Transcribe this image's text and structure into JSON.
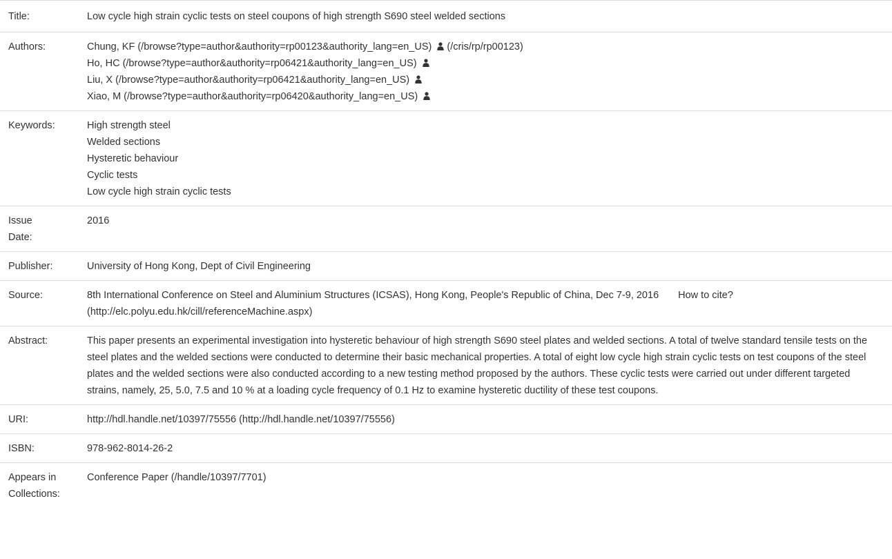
{
  "record": {
    "title": {
      "label": "Title:",
      "value": "Low cycle high strain cyclic tests on steel coupons of high strength S690 steel welded sections"
    },
    "authors": {
      "label": "Authors:",
      "items": [
        {
          "text": "Chung, KF (/browse?type=author&authority=rp00123&authority_lang=en_US)",
          "icon": "user-icon",
          "profile": "(/cris/rp/rp00123)"
        },
        {
          "text": "Ho, HC (/browse?type=author&authority=rp06421&authority_lang=en_US)",
          "icon": "user-icon"
        },
        {
          "text": "Liu, X (/browse?type=author&authority=rp06421&authority_lang=en_US)",
          "icon": "user-icon"
        },
        {
          "text": "Xiao, M (/browse?type=author&authority=rp06420&authority_lang=en_US)",
          "icon": "user-icon"
        }
      ]
    },
    "keywords": {
      "label": "Keywords:",
      "items": [
        "High strength steel",
        "Welded sections",
        "Hysteretic behaviour",
        "Cyclic tests",
        "Low cycle high strain cyclic tests"
      ]
    },
    "issue_date": {
      "label_line1": "Issue",
      "label_line2": "Date:",
      "value": "2016"
    },
    "publisher": {
      "label": "Publisher:",
      "value": "University of Hong Kong, Dept of Civil Engineering"
    },
    "source": {
      "label": "Source:",
      "value": "8th International Conference on Steel and Aluminium Structures (ICSAS), Hong Kong, People's Republic of China, Dec 7-9, 2016",
      "cite_label": "How to cite?",
      "cite_url": "(http://elc.polyu.edu.hk/cill/referenceMachine.aspx)"
    },
    "abstract": {
      "label": "Abstract:",
      "value": "This paper presents an experimental investigation into hysteretic behaviour of high strength S690 steel plates and welded sections. A total of twelve standard tensile tests on the steel plates and the welded sections were conducted to determine their basic mechanical properties. A total of eight low cycle high strain cyclic tests on test coupons of the steel plates and the welded sections were also conducted according to a new testing method proposed by the authors. These cyclic tests were carried out under different targeted strains, namely, 25, 5.0, 7.5 and 10 % at a loading cycle frequency of 0.1 Hz to examine hysteretic ductility of these test coupons."
    },
    "uri": {
      "label": "URI:",
      "value": "http://hdl.handle.net/10397/75556 (http://hdl.handle.net/10397/75556)"
    },
    "isbn": {
      "label": "ISBN:",
      "value": "978-962-8014-26-2"
    },
    "collections": {
      "label_line1": "Appears in",
      "label_line2": "Collections:",
      "value": "Conference Paper (/handle/10397/7701)"
    }
  }
}
